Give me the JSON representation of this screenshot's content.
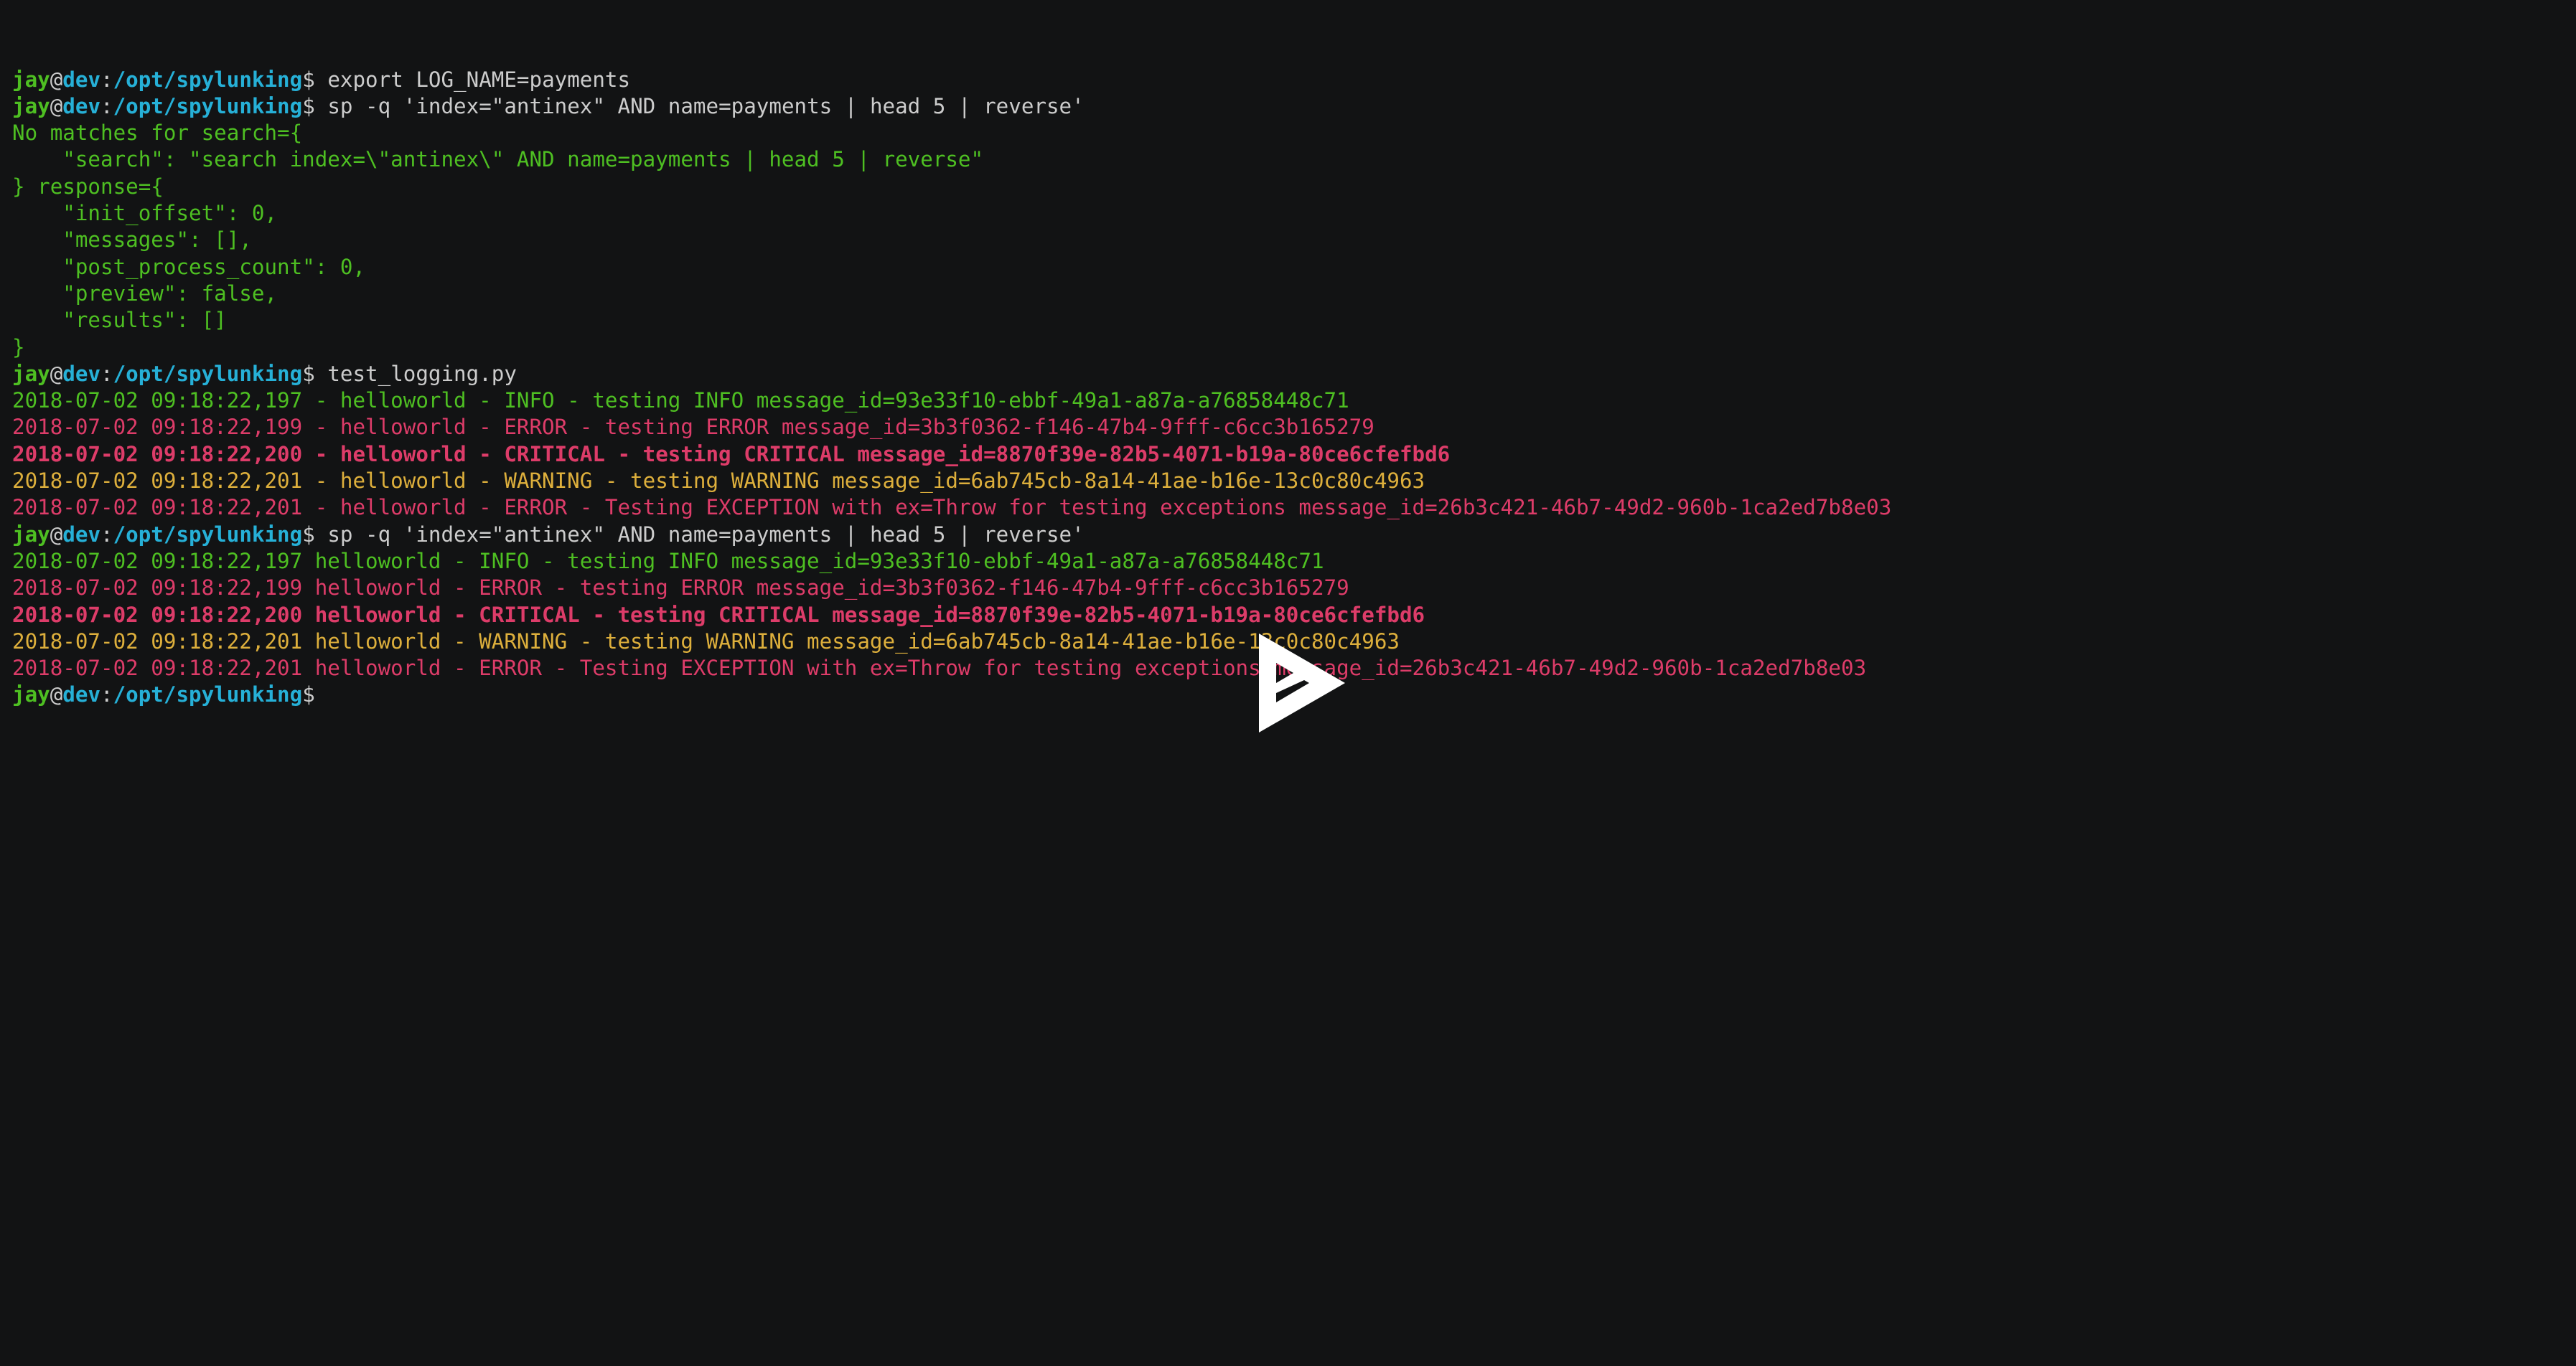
{
  "colors": {
    "background": "#121314",
    "foreground": "#cccccc",
    "green": "#4ebf22",
    "blue": "#26b0d7",
    "red": "#dd3c69",
    "yellow": "#ddaf3c",
    "logo": "#ffffff"
  },
  "prompt": {
    "user": "jay",
    "at": "@",
    "host": "dev",
    "colon": ":",
    "path": "/opt/spylunking",
    "symbol": "$"
  },
  "lines": [
    {
      "type": "prompt",
      "command": " export LOG_NAME=payments"
    },
    {
      "type": "prompt",
      "command": " sp -q 'index=\"antinex\" AND name=payments | head 5 | reverse'"
    },
    {
      "type": "output",
      "style": "green",
      "text": "No matches for search={"
    },
    {
      "type": "output",
      "style": "green",
      "text": "    \"search\": \"search index=\\\"antinex\\\" AND name=payments | head 5 | reverse\""
    },
    {
      "type": "output",
      "style": "green",
      "text": "} response={"
    },
    {
      "type": "output",
      "style": "green",
      "text": "    \"init_offset\": 0,"
    },
    {
      "type": "output",
      "style": "green",
      "text": "    \"messages\": [],"
    },
    {
      "type": "output",
      "style": "green",
      "text": "    \"post_process_count\": 0,"
    },
    {
      "type": "output",
      "style": "green",
      "text": "    \"preview\": false,"
    },
    {
      "type": "output",
      "style": "green",
      "text": "    \"results\": []"
    },
    {
      "type": "output",
      "style": "green",
      "text": "}"
    },
    {
      "type": "prompt",
      "command": " test_logging.py"
    },
    {
      "type": "output",
      "style": "green",
      "text": "2018-07-02 09:18:22,197 - helloworld - INFO - testing INFO message_id=93e33f10-ebbf-49a1-a87a-a76858448c71"
    },
    {
      "type": "output",
      "style": "red",
      "text": "2018-07-02 09:18:22,199 - helloworld - ERROR - testing ERROR message_id=3b3f0362-f146-47b4-9fff-c6cc3b165279"
    },
    {
      "type": "output",
      "style": "red-bold",
      "text": "2018-07-02 09:18:22,200 - helloworld - CRITICAL - testing CRITICAL message_id=8870f39e-82b5-4071-b19a-80ce6cfefbd6"
    },
    {
      "type": "output",
      "style": "yellow",
      "text": "2018-07-02 09:18:22,201 - helloworld - WARNING - testing WARNING message_id=6ab745cb-8a14-41ae-b16e-13c0c80c4963"
    },
    {
      "type": "output",
      "style": "red",
      "text": "2018-07-02 09:18:22,201 - helloworld - ERROR - Testing EXCEPTION with ex=Throw for testing exceptions message_id=26b3c421-46b7-49d2-960b-1ca2ed7b8e03"
    },
    {
      "type": "prompt",
      "command": " sp -q 'index=\"antinex\" AND name=payments | head 5 | reverse'"
    },
    {
      "type": "output",
      "style": "green",
      "text": "2018-07-02 09:18:22,197 helloworld - INFO - testing INFO message_id=93e33f10-ebbf-49a1-a87a-a76858448c71"
    },
    {
      "type": "output",
      "style": "red",
      "text": "2018-07-02 09:18:22,199 helloworld - ERROR - testing ERROR message_id=3b3f0362-f146-47b4-9fff-c6cc3b165279"
    },
    {
      "type": "output",
      "style": "red-bold",
      "text": "2018-07-02 09:18:22,200 helloworld - CRITICAL - testing CRITICAL message_id=8870f39e-82b5-4071-b19a-80ce6cfefbd6"
    },
    {
      "type": "output",
      "style": "yellow",
      "text": "2018-07-02 09:18:22,201 helloworld - WARNING - testing WARNING message_id=6ab745cb-8a14-41ae-b16e-13c0c80c4963"
    },
    {
      "type": "output",
      "style": "red",
      "text": "2018-07-02 09:18:22,201 helloworld - ERROR - Testing EXCEPTION with ex=Throw for testing exceptions message_id=26b3c421-46b7-49d2-960b-1ca2ed7b8e03"
    },
    {
      "type": "prompt",
      "command": ""
    }
  ],
  "player": {
    "icon": "asciinema-play-icon",
    "label": "Play"
  }
}
